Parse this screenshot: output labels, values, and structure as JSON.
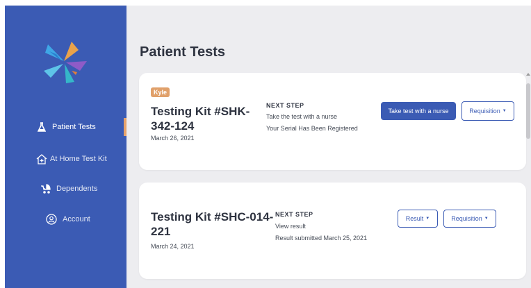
{
  "sidebar": {
    "items": [
      {
        "label": "Patient Tests",
        "icon": "flask-icon",
        "active": true
      },
      {
        "label": "At Home Test Kit",
        "icon": "home-plus-icon",
        "active": false
      },
      {
        "label": "Dependents",
        "icon": "stroller-icon",
        "active": false
      },
      {
        "label": "Account",
        "icon": "user-circle-icon",
        "active": false
      }
    ]
  },
  "main": {
    "title": "Patient Tests",
    "tests": [
      {
        "badge": "Kyle",
        "title_line1": "Testing Kit #SHK-",
        "title_line2": "342-124",
        "date": "March 26, 2021",
        "next_step_heading": "NEXT STEP",
        "step_lines": [
          "Take the test with a nurse",
          "Your Serial Has Been Registered"
        ],
        "primary_action": "Take test with a nurse",
        "secondary_action": "Requisition"
      },
      {
        "title_line1": "Testing Kit #SHC-014-",
        "title_line2": "221",
        "date": "March 24, 2021",
        "next_step_heading": "NEXT STEP",
        "step_lines": [
          "View result",
          "Result submitted March 25, 2021"
        ],
        "primary_action": "Result",
        "secondary_action": "Requisition"
      }
    ]
  },
  "colors": {
    "brand_blue": "#3b5bb4",
    "accent_orange": "#e0a06a",
    "background": "#ededf0"
  }
}
